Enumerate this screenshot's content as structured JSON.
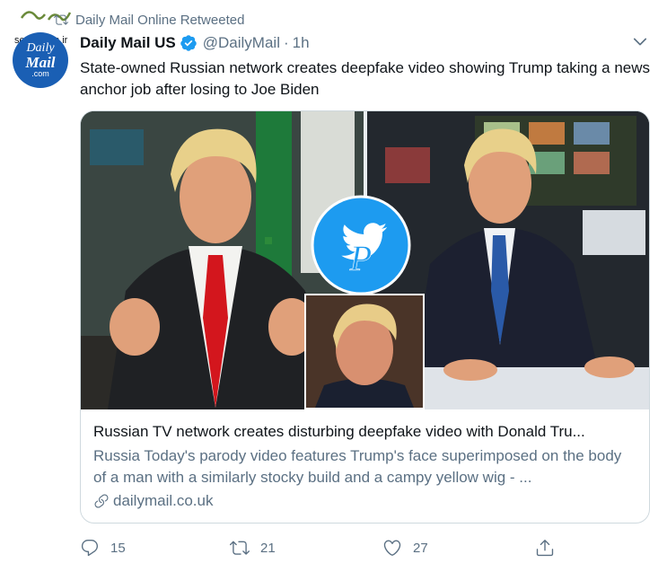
{
  "watermark": {
    "text": "seratnews.ir"
  },
  "retweet": {
    "label": "Daily Mail Online Retweeted"
  },
  "avatar": {
    "line1": "Daily",
    "line2": "Mail",
    "line3": ".com"
  },
  "tweet": {
    "display_name": "Daily Mail US",
    "handle": "@DailyMail",
    "separator": "·",
    "time": "1h",
    "text": "State-owned Russian network creates deepfake video showing Trump taking a news anchor job after losing to Joe Biden"
  },
  "card": {
    "title": "Russian TV network creates disturbing deepfake video with Donald Tru...",
    "description": "Russia Today's parody video features Trump's face superimposed on the body of a man with a similarly stocky build and a campy yellow wig - ...",
    "domain": "dailymail.co.uk"
  },
  "actions": {
    "reply_count": "15",
    "retweet_count": "21",
    "like_count": "27"
  },
  "icons": [
    "retweet-icon",
    "verified-icon",
    "chevron-down-icon",
    "link-icon",
    "reply-icon",
    "like-icon",
    "share-icon",
    "twitter-bird-icon"
  ],
  "colors": {
    "accent": "#1d9bf0",
    "muted": "#5b7083",
    "text": "#0f1419",
    "border": "#cfd9de"
  }
}
